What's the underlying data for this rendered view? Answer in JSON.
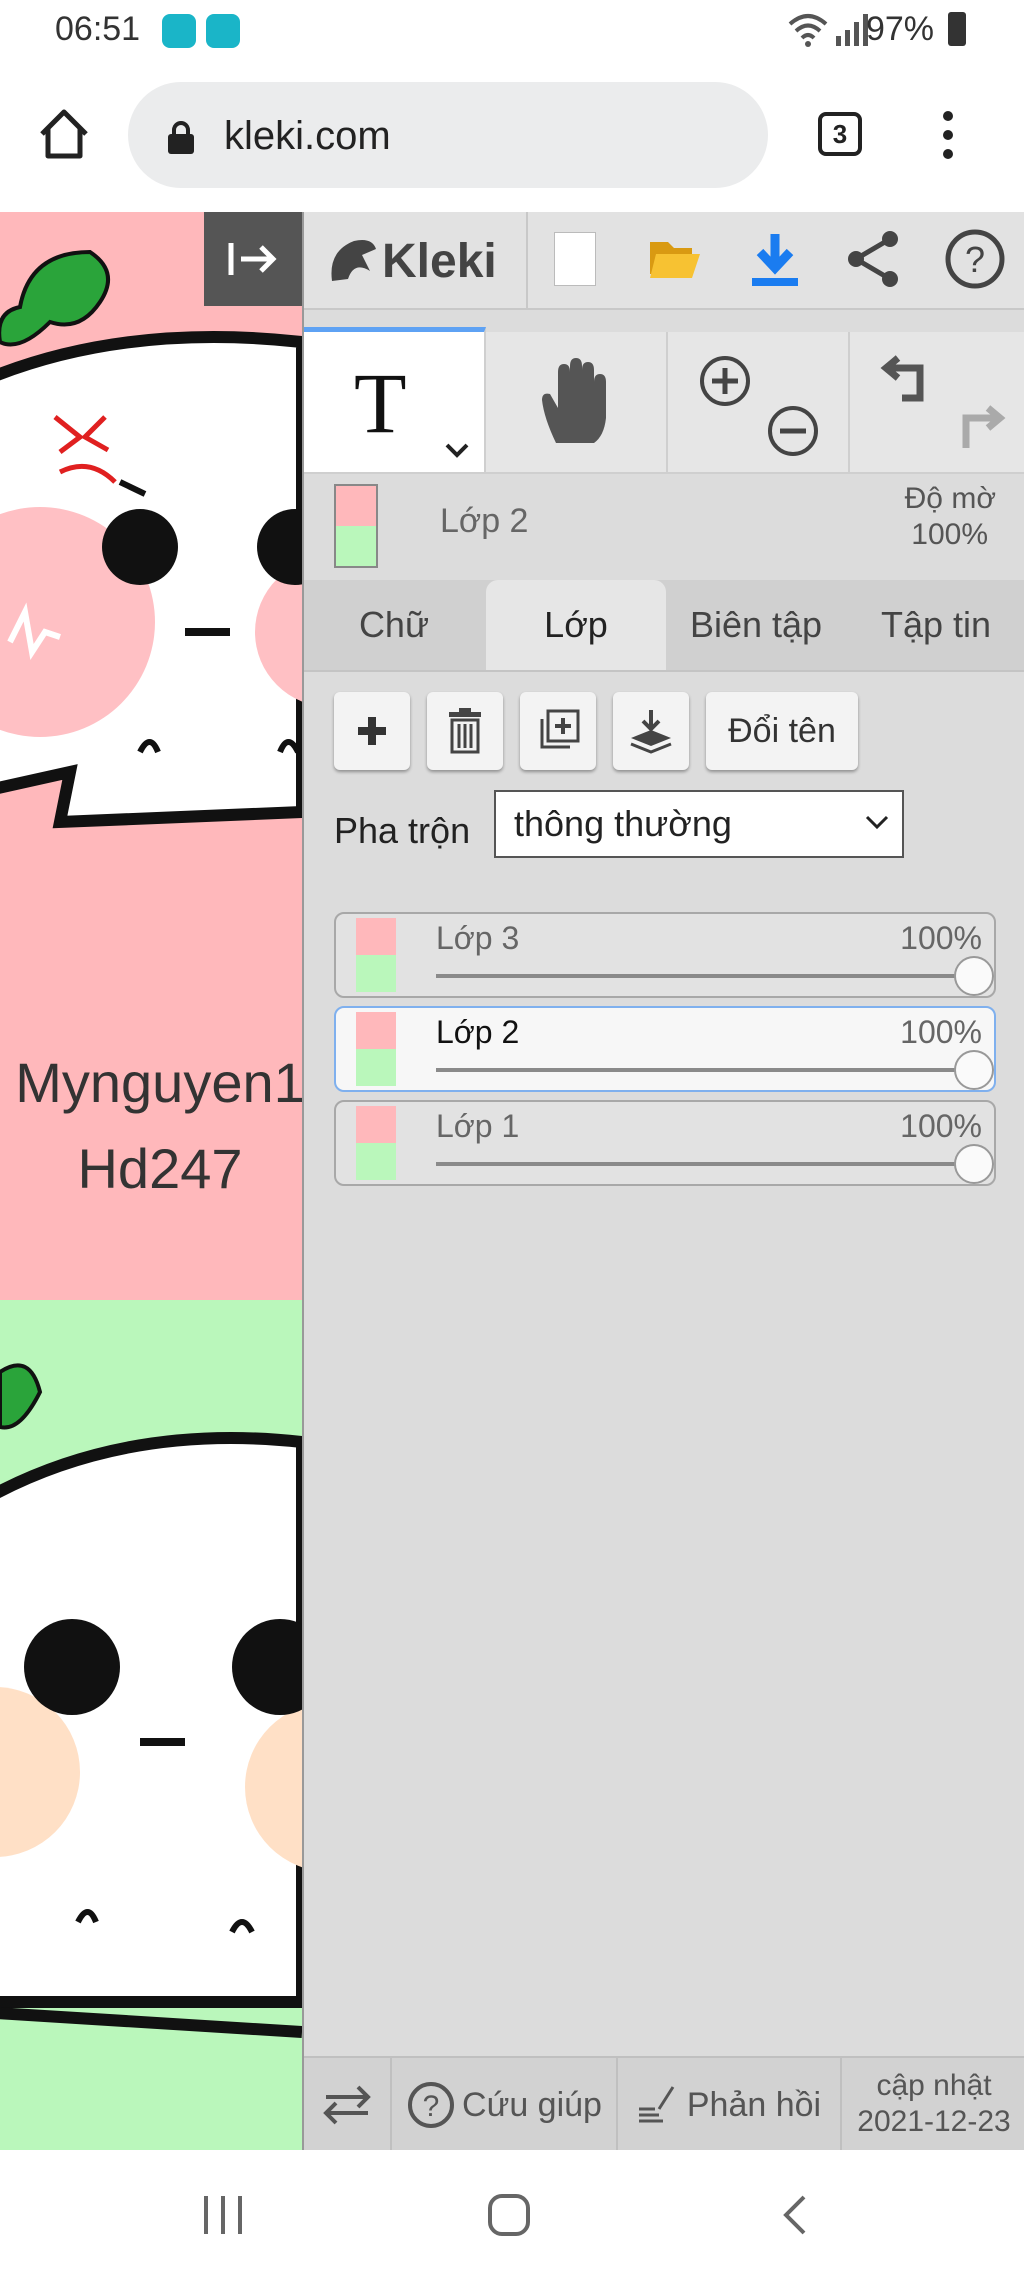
{
  "status_bar": {
    "time": "06:51",
    "battery": "97%"
  },
  "browser": {
    "url": "kleki.com",
    "tab_count": "3"
  },
  "canvas": {
    "watermark_line1": "Mynguyen1",
    "watermark_line2": "Hd247"
  },
  "app": {
    "logo": "Kleki"
  },
  "layer_info": {
    "current_layer": "Lớp 2",
    "opacity_label": "Độ mờ",
    "opacity_value": "100%"
  },
  "tabs": [
    {
      "label": "Chữ"
    },
    {
      "label": "Lớp"
    },
    {
      "label": "Biên tập"
    },
    {
      "label": "Tập tin"
    }
  ],
  "layer_panel": {
    "rename_label": "Đổi tên",
    "blend_label": "Pha trộn",
    "blend_mode": "thông thường"
  },
  "layers": [
    {
      "name": "Lớp 3",
      "opacity": "100%"
    },
    {
      "name": "Lớp 2",
      "opacity": "100%"
    },
    {
      "name": "Lớp 1",
      "opacity": "100%"
    }
  ],
  "bottom": {
    "help_label": "Cứu giúp",
    "feedback_label": "Phản hồi",
    "update_label": "cập nhật",
    "update_date": "2021-12-23"
  },
  "colors": {
    "accent": "#5ea2f4",
    "canvas_pink": "#ffb8bb",
    "canvas_green": "#baf7bb"
  }
}
